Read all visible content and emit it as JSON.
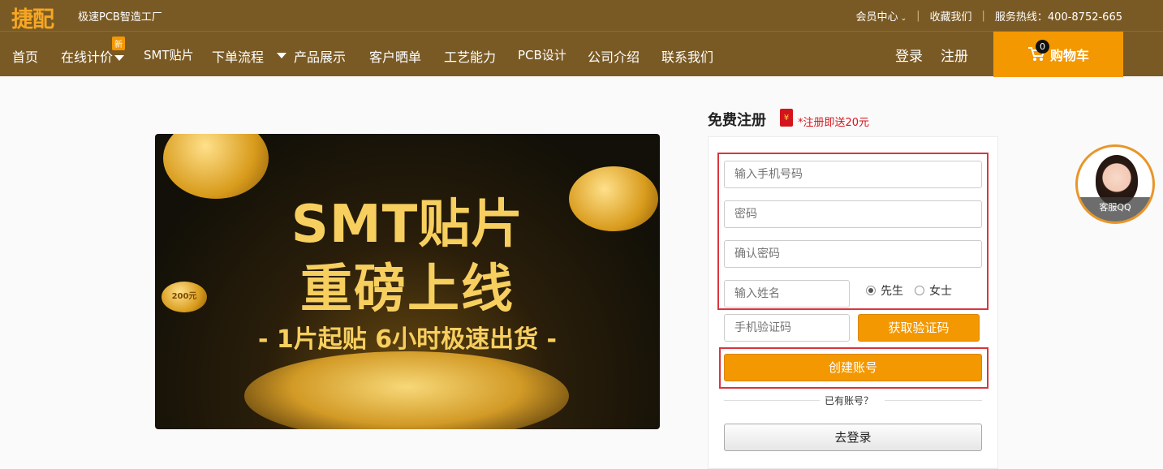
{
  "header": {
    "logo": "捷配",
    "slogan": "极速PCB智造工厂",
    "member_center": "会员中心",
    "favorite": "收藏我们",
    "hotline": "服务热线：400-8752-665"
  },
  "nav": {
    "items": [
      "首页",
      "在线计价",
      "SMT贴片",
      "下单流程",
      "产品展示",
      "客户晒单",
      "工艺能力",
      "PCB设计",
      "公司介绍",
      "联系我们"
    ],
    "new_badge": "新",
    "login": "登录",
    "register": "注册",
    "cart_label": "购物车",
    "cart_count": "0"
  },
  "banner": {
    "line1": "SMT贴片",
    "line2": "重磅上线",
    "line3": "- 1片起贴 6小时极速出货 -",
    "coin_text": "200元"
  },
  "form": {
    "title": "免费注册",
    "envelope_symbol": "¥",
    "promo": "*注册即送20元",
    "phone_placeholder": "输入手机号码",
    "password_placeholder": "密码",
    "confirm_placeholder": "确认密码",
    "name_placeholder": "输入姓名",
    "gender_male": "先生",
    "gender_female": "女士",
    "code_placeholder": "手机验证码",
    "get_code": "获取验证码",
    "create_account": "创建账号",
    "have_account": "已有账号？",
    "go_login": "去登录"
  },
  "support": {
    "label": "客服QQ"
  },
  "colors": {
    "header_brown": "#7a5a24",
    "accent_orange": "#f39800",
    "highlight_red": "#d9363e"
  }
}
